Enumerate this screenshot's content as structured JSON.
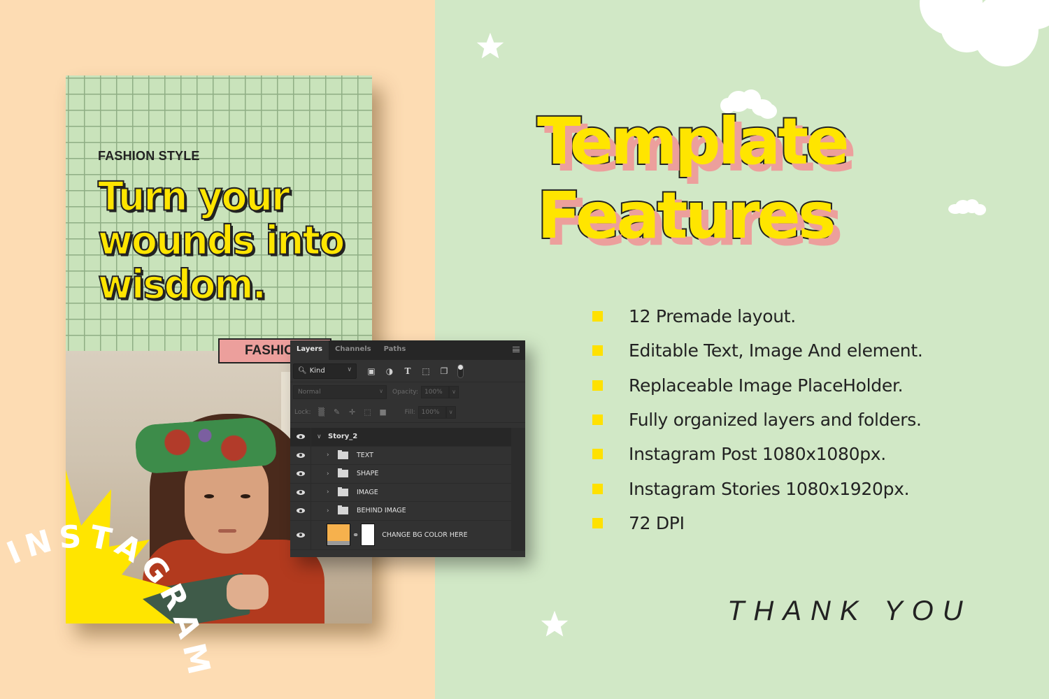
{
  "colors": {
    "left_bg": "#fddcb3",
    "right_bg": "#d1e8c6",
    "accent_yellow": "#ffe500",
    "accent_pink": "#ec9f9c",
    "text_dark": "#222222",
    "swatch_orange": "#f6b14d"
  },
  "story_mockup": {
    "kicker": "FASHION STYLE",
    "headline_lines": [
      "Turn your",
      "wounds into",
      "wisdom."
    ],
    "tag": "FASHIO",
    "arc_text": "INSTAGRAM"
  },
  "layers_panel": {
    "tabs": [
      {
        "label": "Layers",
        "active": true
      },
      {
        "label": "Channels",
        "active": false
      },
      {
        "label": "Paths",
        "active": false
      }
    ],
    "filter": {
      "label": "Kind"
    },
    "filter_icons": [
      "image-filter-icon",
      "adjustment-filter-icon",
      "type-filter-icon",
      "shape-filter-icon",
      "smart-object-filter-icon"
    ],
    "blend_mode": "Normal",
    "opacity_label": "Opacity:",
    "opacity_value": "100%",
    "lock_label": "Lock:",
    "fill_label": "Fill:",
    "fill_value": "100%",
    "group": {
      "name": "Story_2",
      "expanded": true
    },
    "layers": [
      {
        "name": "TEXT",
        "type": "folder"
      },
      {
        "name": "SHAPE",
        "type": "folder"
      },
      {
        "name": "IMAGE",
        "type": "folder"
      },
      {
        "name": "BEHIND IMAGE",
        "type": "folder"
      },
      {
        "name": "CHANGE BG COLOR HERE",
        "type": "fill"
      }
    ]
  },
  "features_section": {
    "title_line1": "Template",
    "title_line2": "Features",
    "items": [
      "12 Premade layout.",
      "Editable Text, Image And element.",
      "Replaceable Image PlaceHolder.",
      "Fully organized layers and folders.",
      "Instagram Post 1080x1080px.",
      "Instagram Stories 1080x1920px.",
      "72 DPI"
    ],
    "closing": "THANK YOU"
  }
}
